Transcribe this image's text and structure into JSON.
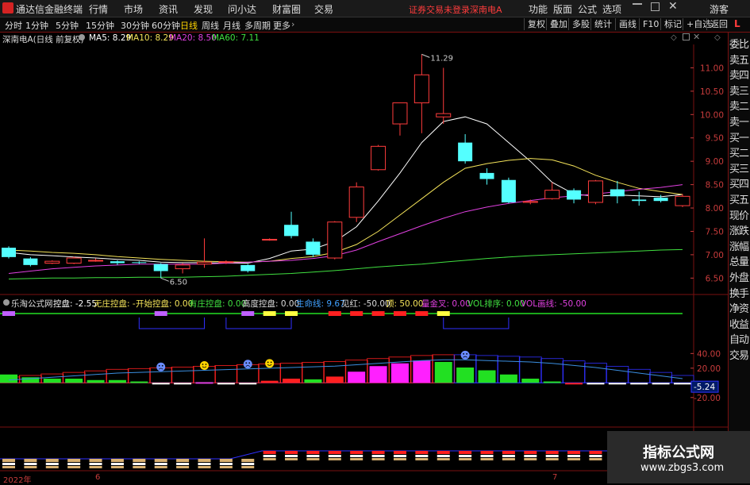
{
  "app": {
    "title": "通达信金融终端",
    "menu": [
      "行情",
      "市场",
      "资讯",
      "发现",
      "问小达",
      "财富圈",
      "交易"
    ],
    "status": "证券交易未登录",
    "stock_title": "深南电A",
    "right_menu": [
      "功能",
      "版面",
      "公式",
      "选项"
    ],
    "guest": "游客"
  },
  "toolbar": {
    "periods": [
      "分时",
      "1分钟",
      "5分钟",
      "15分钟",
      "30分钟",
      "60分钟",
      "日线",
      "周线",
      "月线",
      "多周期",
      "更多"
    ],
    "active_period": "日线",
    "buttons": [
      "复权",
      "叠加",
      "多股",
      "统计",
      "画线",
      "F10",
      "标记",
      "+自选",
      "返回"
    ],
    "corner": "L"
  },
  "chart_header": {
    "name": "深南电A(日线 前复权)",
    "ma": [
      {
        "label": "MA5: 8.29",
        "color": "#ffffff"
      },
      {
        "label": "MA10: 8.29",
        "color": "#f5e45a"
      },
      {
        "label": "MA20: 8.50",
        "color": "#e040e0"
      },
      {
        "label": "MA60: 7.11",
        "color": "#40e040"
      }
    ]
  },
  "side_panel": [
    "委比",
    "卖五",
    "卖四",
    "卖三",
    "卖二",
    "卖一",
    "买一",
    "买二",
    "买三",
    "买四",
    "买五",
    "现价",
    "涨跌",
    "涨幅",
    "总量",
    "外盘",
    "换手",
    "净资",
    "收益",
    "自动",
    "交易"
  ],
  "indicator_header": [
    {
      "label": "乐淘公式网",
      "color": "#dddddd"
    },
    {
      "label": "控盘: -2.55",
      "color": "#ffffff"
    },
    {
      "label": "无庄控盘: -",
      "color": "#f5e45a"
    },
    {
      "label": "开始控盘: 0.00",
      "color": "#f5e45a"
    },
    {
      "label": "有庄控盘: 0.00",
      "color": "#40e040"
    },
    {
      "label": "高度控盘: 0.00",
      "color": "#dddddd"
    },
    {
      "label": "生命线: 9.67",
      "color": "#40a0ff"
    },
    {
      "label": "见红: -50.00",
      "color": "#dddddd"
    },
    {
      "label": "顶: 50.00",
      "color": "#f5e45a"
    },
    {
      "label": "量金叉: 0.00",
      "color": "#e040e0"
    },
    {
      "label": "VOL排序: 0.00",
      "color": "#40e040"
    },
    {
      "label": "VOL画线: -50.00",
      "color": "#e040e0"
    }
  ],
  "x_axis": [
    "2022年",
    "6",
    "7"
  ],
  "watermark": {
    "line1": "指标公式网",
    "line2": "www.zbgs3.com"
  },
  "chart_data": [
    {
      "type": "candlestick",
      "title": "深南电A(日线 前复权)",
      "y_ticks": [
        11.0,
        10.5,
        10.0,
        9.5,
        9.0,
        8.5,
        8.0,
        7.5,
        7.0,
        6.5
      ],
      "ylim": [
        6.2,
        11.5
      ],
      "annotations": [
        {
          "label": "11.29",
          "value": 11.29,
          "index": 19
        },
        {
          "label": "6.50",
          "value": 6.5,
          "index": 7
        }
      ],
      "candles": [
        {
          "o": 7.15,
          "h": 7.18,
          "c": 6.95,
          "l": 6.92
        },
        {
          "o": 6.92,
          "h": 6.95,
          "c": 6.78,
          "l": 6.75
        },
        {
          "o": 6.82,
          "h": 6.88,
          "c": 6.86,
          "l": 6.8
        },
        {
          "o": 6.82,
          "h": 6.96,
          "c": 6.93,
          "l": 6.8
        },
        {
          "o": 6.88,
          "h": 6.92,
          "c": 6.88,
          "l": 6.85
        },
        {
          "o": 6.86,
          "h": 6.88,
          "c": 6.82,
          "l": 6.78
        },
        {
          "o": 6.84,
          "h": 6.86,
          "c": 6.83,
          "l": 6.8
        },
        {
          "o": 6.8,
          "h": 6.82,
          "c": 6.65,
          "l": 6.5
        },
        {
          "o": 6.7,
          "h": 6.82,
          "c": 6.78,
          "l": 6.6
        },
        {
          "o": 6.8,
          "h": 7.35,
          "c": 6.84,
          "l": 6.72
        },
        {
          "o": 6.85,
          "h": 6.88,
          "c": 6.85,
          "l": 6.8
        },
        {
          "o": 6.78,
          "h": 6.8,
          "c": 6.65,
          "l": 6.62
        },
        {
          "o": 7.33,
          "h": 7.35,
          "c": 7.33,
          "l": 7.3
        },
        {
          "o": 7.64,
          "h": 7.92,
          "c": 7.4,
          "l": 7.35
        },
        {
          "o": 7.28,
          "h": 7.35,
          "c": 7.0,
          "l": 6.95
        },
        {
          "o": 6.93,
          "h": 7.72,
          "c": 7.7,
          "l": 6.9
        },
        {
          "o": 7.8,
          "h": 8.55,
          "c": 8.45,
          "l": 7.7
        },
        {
          "o": 8.82,
          "h": 9.35,
          "c": 9.32,
          "l": 8.8
        },
        {
          "o": 9.8,
          "h": 10.25,
          "c": 10.25,
          "l": 9.55
        },
        {
          "o": 10.25,
          "h": 11.29,
          "c": 10.85,
          "l": 9.6
        },
        {
          "o": 9.95,
          "h": 11.0,
          "c": 10.02,
          "l": 9.8
        },
        {
          "o": 9.4,
          "h": 9.58,
          "c": 9.0,
          "l": 8.95
        },
        {
          "o": 8.75,
          "h": 8.85,
          "c": 8.62,
          "l": 8.5
        },
        {
          "o": 8.6,
          "h": 8.65,
          "c": 8.12,
          "l": 8.1
        },
        {
          "o": 8.12,
          "h": 8.18,
          "c": 8.14,
          "l": 8.08
        },
        {
          "o": 8.2,
          "h": 8.55,
          "c": 8.38,
          "l": 8.18
        },
        {
          "o": 8.38,
          "h": 8.42,
          "c": 8.18,
          "l": 8.1
        },
        {
          "o": 8.12,
          "h": 8.6,
          "c": 8.58,
          "l": 8.08
        },
        {
          "o": 8.4,
          "h": 8.58,
          "c": 8.25,
          "l": 8.1
        },
        {
          "o": 8.18,
          "h": 8.35,
          "c": 8.15,
          "l": 8.05
        },
        {
          "o": 8.22,
          "h": 8.28,
          "c": 8.15,
          "l": 8.12
        },
        {
          "o": 8.05,
          "h": 8.3,
          "c": 8.25,
          "l": 8.02
        }
      ],
      "ma_lines": [
        {
          "name": "MA5",
          "color": "#ffffff",
          "values": [
            7.05,
            7.0,
            6.98,
            6.95,
            6.93,
            6.9,
            6.88,
            6.84,
            6.83,
            6.83,
            6.82,
            6.82,
            6.92,
            7.08,
            7.12,
            7.28,
            7.6,
            8.15,
            8.75,
            9.4,
            9.85,
            9.95,
            9.8,
            9.4,
            9.0,
            8.55,
            8.3,
            8.25,
            8.28,
            8.26,
            8.24,
            8.29
          ]
        },
        {
          "name": "MA10",
          "color": "#f5e45a",
          "values": [
            7.1,
            7.08,
            7.05,
            7.03,
            7.0,
            6.96,
            6.93,
            6.9,
            6.88,
            6.86,
            6.85,
            6.84,
            6.86,
            6.92,
            6.96,
            7.05,
            7.22,
            7.5,
            7.85,
            8.2,
            8.55,
            8.85,
            8.95,
            9.02,
            9.06,
            9.03,
            8.9,
            8.7,
            8.55,
            8.42,
            8.35,
            8.29
          ]
        },
        {
          "name": "MA20",
          "color": "#e040e0",
          "values": [
            6.6,
            6.65,
            6.7,
            6.73,
            6.76,
            6.78,
            6.8,
            6.8,
            6.8,
            6.8,
            6.82,
            6.84,
            6.86,
            6.88,
            6.92,
            6.98,
            7.1,
            7.28,
            7.45,
            7.62,
            7.78,
            7.92,
            8.02,
            8.1,
            8.16,
            8.22,
            8.26,
            8.3,
            8.35,
            8.4,
            8.44,
            8.5
          ]
        },
        {
          "name": "MA60",
          "color": "#40e040",
          "values": [
            6.48,
            6.49,
            6.5,
            6.5,
            6.51,
            6.51,
            6.52,
            6.52,
            6.52,
            6.53,
            6.54,
            6.56,
            6.58,
            6.6,
            6.63,
            6.66,
            6.7,
            6.74,
            6.77,
            6.8,
            6.84,
            6.88,
            6.92,
            6.95,
            6.98,
            7.0,
            7.02,
            7.04,
            7.06,
            7.08,
            7.1,
            7.11
          ]
        }
      ]
    },
    {
      "type": "bar",
      "title": "乐淘公式网",
      "y_ticks": [
        40.0,
        20.0,
        -20.0
      ],
      "ylim": [
        -30,
        48
      ],
      "last_value_label": "-5.24",
      "last_value": -5.24,
      "bars": [
        {
          "v": 6,
          "c": "#22e022"
        },
        {
          "v": 4,
          "c": "#22e022"
        },
        {
          "v": 3,
          "c": "#22e022"
        },
        {
          "v": 3,
          "c": "#22e022"
        },
        {
          "v": 2,
          "c": "#22e022"
        },
        {
          "v": 2,
          "c": "#22e022"
        },
        {
          "v": 1,
          "c": "#22e022"
        },
        {
          "v": -0.5,
          "c": "#ffffff"
        },
        {
          "v": -0.5,
          "c": "#ffffff"
        },
        {
          "v": 0.5,
          "c": "#e040e0"
        },
        {
          "v": -0.5,
          "c": "#ffffff"
        },
        {
          "v": -1,
          "c": "#ffffff"
        },
        {
          "v": 1.5,
          "c": "#ff2020"
        },
        {
          "v": 3,
          "c": "#ff2020"
        },
        {
          "v": 2.5,
          "c": "#22e022"
        },
        {
          "v": 4.5,
          "c": "#ff2020"
        },
        {
          "v": 8,
          "c": "#ff20ff"
        },
        {
          "v": 12,
          "c": "#ff20ff"
        },
        {
          "v": 14,
          "c": "#ff20ff"
        },
        {
          "v": 16,
          "c": "#ff20ff"
        },
        {
          "v": 15,
          "c": "#22e022"
        },
        {
          "v": 11,
          "c": "#22e022"
        },
        {
          "v": 9,
          "c": "#22e022"
        },
        {
          "v": 6,
          "c": "#22e022"
        },
        {
          "v": 3,
          "c": "#22e022"
        },
        {
          "v": 1,
          "c": "#22e022"
        },
        {
          "v": -0.5,
          "c": "#ff2020"
        },
        {
          "v": -0.5,
          "c": "#ffffff"
        },
        {
          "v": -1,
          "c": "#ffffff"
        },
        {
          "v": -1,
          "c": "#ffffff"
        },
        {
          "v": -1,
          "c": "#ffffff"
        },
        {
          "v": -1,
          "c": "#ffffff"
        }
      ],
      "life_line": [
        2,
        3,
        4,
        5,
        6,
        7,
        7.5,
        8,
        8.5,
        9,
        9.5,
        10,
        10.5,
        11,
        11.5,
        12,
        13,
        14,
        15,
        16,
        16.5,
        16.5,
        16,
        15.5,
        15,
        14,
        12.5,
        11,
        9,
        7,
        5,
        3
      ],
      "faces": [
        {
          "index": 7,
          "kind": "sad"
        },
        {
          "index": 9,
          "kind": "happy"
        },
        {
          "index": 11,
          "kind": "sad"
        },
        {
          "index": 12,
          "kind": "happy"
        },
        {
          "index": 21,
          "kind": "sad"
        }
      ]
    }
  ]
}
